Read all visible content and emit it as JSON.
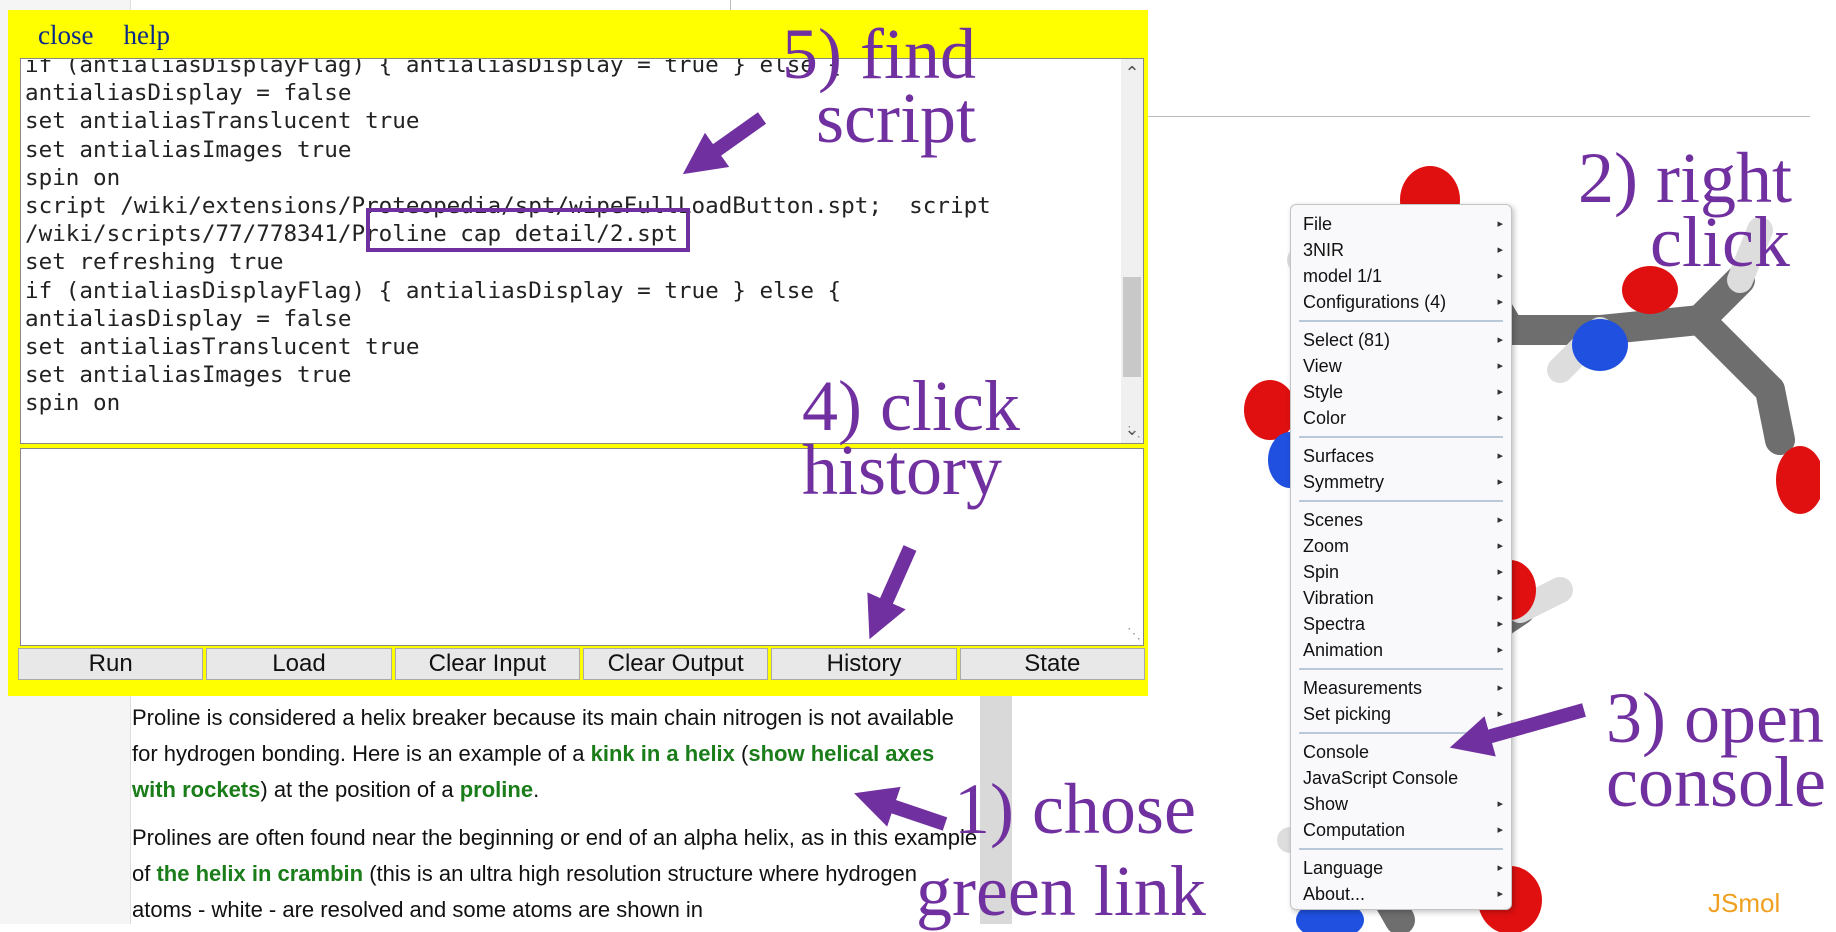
{
  "console": {
    "menu": {
      "close": "close",
      "help": "help"
    },
    "script_lines": [
      "if (antialiasDisplayFlag) { antialiasDisplay = true } else {",
      "antialiasDisplay = false",
      "set antialiasTranslucent true",
      "set antialiasImages true",
      "spin on",
      "script /wiki/extensions/Proteopedia/spt/wipeFullLoadButton.spt;  script",
      "/wiki/scripts/77/778341/Proline cap detail/2.spt",
      "set refreshing true",
      "if (antialiasDisplayFlag) { antialiasDisplay = true } else {",
      "antialiasDisplay = false",
      "set antialiasTranslucent true",
      "set antialiasImages true",
      "spin on"
    ],
    "buttons": [
      "Run",
      "Load",
      "Clear Input",
      "Clear Output",
      "History",
      "State"
    ]
  },
  "article": {
    "p1_a": "Proline is considered a helix breaker because its main chain nitrogen is not available for hydrogen bonding. Here is an example of a ",
    "p1_link1": "kink in a helix",
    "p1_b": " (",
    "p1_link2": "show helical axes with rockets",
    "p1_c": ") at the position of a ",
    "p1_link3": "proline",
    "p1_d": ".",
    "p2_a": "Prolines are often found near the beginning or end of an alpha helix, as in this example of ",
    "p2_link": "the helix in crambin",
    "p2_b": " (this is an ultra high resolution structure where hydrogen atoms - white - are resolved and some atoms are shown in"
  },
  "context_menu": {
    "groups": [
      [
        "File",
        "3NIR",
        "model 1/1",
        "Configurations (4)"
      ],
      [
        "Select (81)",
        "View",
        "Style",
        "Color"
      ],
      [
        "Surfaces",
        "Symmetry"
      ],
      [
        "Scenes",
        "Zoom",
        "Spin",
        "Vibration",
        "Spectra",
        "Animation"
      ],
      [
        "Measurements",
        "Set picking"
      ],
      [
        "Console",
        "JavaScript Console",
        "Show",
        "Computation"
      ],
      [
        "Language",
        "About..."
      ]
    ]
  },
  "annotations": {
    "step1": [
      "1) chose",
      "green link"
    ],
    "step2": [
      "2) right",
      "click"
    ],
    "step3": [
      "3) open",
      "console"
    ],
    "step4": [
      "4) click",
      "history"
    ],
    "step5": [
      "5) find",
      "script"
    ]
  },
  "viewer": {
    "logo": "JSmol"
  },
  "colors": {
    "console_bg": "#ffff00",
    "annotation": "#7030a0",
    "link": "#1a7d1a",
    "logo": "#f0a020"
  }
}
